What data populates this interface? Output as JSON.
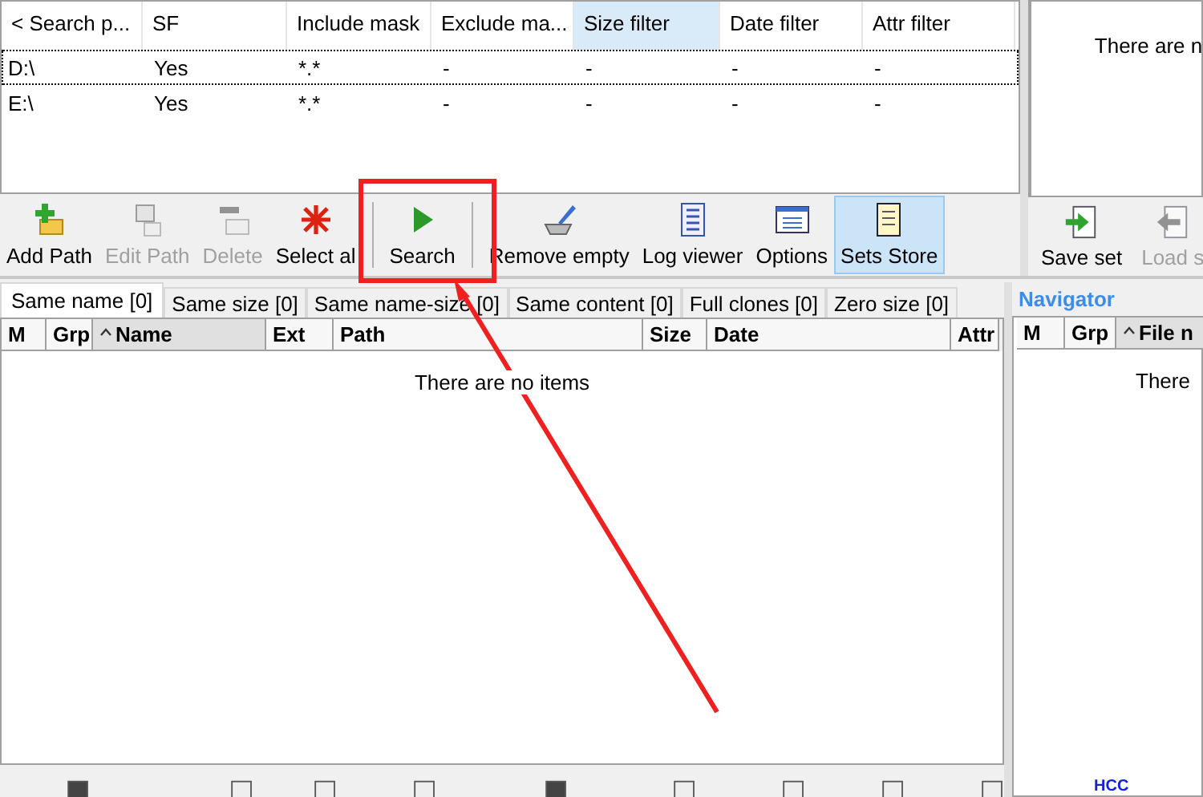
{
  "search_paths": {
    "columns": [
      {
        "label": "< Search p...",
        "selected": false
      },
      {
        "label": "SF",
        "selected": false
      },
      {
        "label": "Include mask",
        "selected": false
      },
      {
        "label": "Exclude ma...",
        "selected": false
      },
      {
        "label": "Size filter",
        "selected": true
      },
      {
        "label": "Date filter",
        "selected": false
      },
      {
        "label": "Attr filter",
        "selected": false
      }
    ],
    "rows": [
      {
        "cells": [
          "D:\\",
          "Yes",
          "*.*",
          "-",
          "-",
          "-",
          "-"
        ],
        "selected": true
      },
      {
        "cells": [
          "E:\\",
          "Yes",
          "*.*",
          "-",
          "-",
          "-",
          "-"
        ],
        "selected": false
      }
    ]
  },
  "sets_panel": {
    "message": "There are n"
  },
  "toolbar": [
    {
      "kind": "button",
      "label": "Add Path",
      "disabled": false,
      "selected": false
    },
    {
      "kind": "button",
      "label": "Edit Path",
      "disabled": true,
      "selected": false
    },
    {
      "kind": "button",
      "label": "Delete",
      "disabled": true,
      "selected": false
    },
    {
      "kind": "button",
      "label": "Select al",
      "disabled": false,
      "selected": false
    },
    {
      "kind": "separator"
    },
    {
      "kind": "button",
      "label": "Search",
      "disabled": false,
      "selected": false
    },
    {
      "kind": "separator"
    },
    {
      "kind": "button",
      "label": "Remove empty",
      "disabled": false,
      "selected": false
    },
    {
      "kind": "button",
      "label": "Log viewer",
      "disabled": false,
      "selected": false
    },
    {
      "kind": "button",
      "label": "Options",
      "disabled": false,
      "selected": false
    },
    {
      "kind": "button",
      "label": "Sets Store",
      "disabled": false,
      "selected": true
    }
  ],
  "sets_toolbar": [
    {
      "kind": "button",
      "label": "Save set",
      "disabled": false,
      "selected": false
    },
    {
      "kind": "button",
      "label": "Load s",
      "disabled": true,
      "selected": false
    }
  ],
  "tabs": [
    {
      "label": "Same name [0]",
      "selected": true
    },
    {
      "label": "Same size [0]",
      "selected": false
    },
    {
      "label": "Same name-size [0]",
      "selected": false
    },
    {
      "label": "Same content [0]",
      "selected": false
    },
    {
      "label": "Full clones [0]",
      "selected": false
    },
    {
      "label": "Zero size [0]",
      "selected": false
    }
  ],
  "results": {
    "columns": [
      {
        "label": "M",
        "sorted": false
      },
      {
        "label": "Grp",
        "sorted": false
      },
      {
        "label": "Name",
        "sorted": true
      },
      {
        "label": "Ext",
        "sorted": false
      },
      {
        "label": "Path",
        "sorted": false
      },
      {
        "label": "Size",
        "sorted": false
      },
      {
        "label": "Date",
        "sorted": false
      },
      {
        "label": "Attr",
        "sorted": false
      }
    ],
    "message": "There are no items"
  },
  "navigator": {
    "title": "Navigator",
    "columns": [
      {
        "label": "M",
        "sorted": false
      },
      {
        "label": "Grp",
        "sorted": false
      },
      {
        "label": "File n",
        "sorted": true
      }
    ],
    "message": "There",
    "logo": "HCC"
  }
}
